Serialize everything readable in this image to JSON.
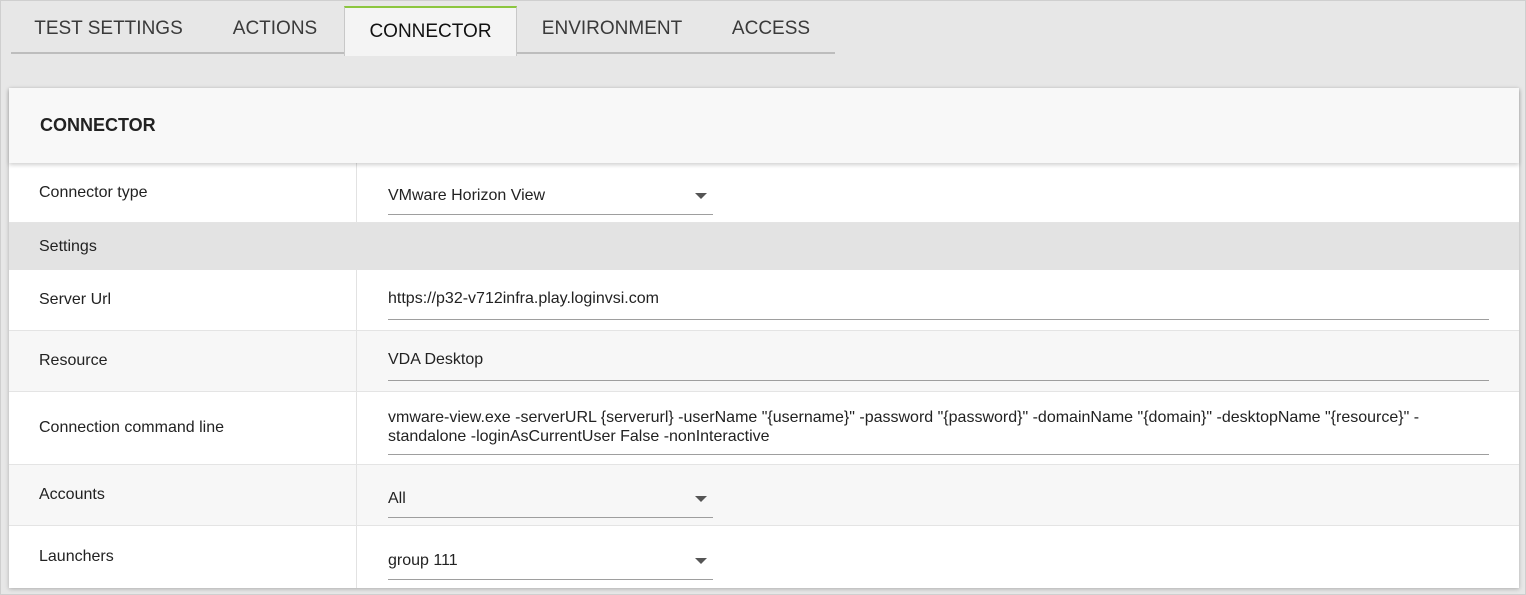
{
  "tabs": [
    {
      "label": "TEST SETTINGS"
    },
    {
      "label": "ACTIONS"
    },
    {
      "label": "CONNECTOR"
    },
    {
      "label": "ENVIRONMENT"
    },
    {
      "label": "ACCESS"
    }
  ],
  "active_tab": "CONNECTOR",
  "panel": {
    "title": "CONNECTOR",
    "connector_type": {
      "label": "Connector type",
      "value": "VMware Horizon View"
    },
    "settings_header": "Settings",
    "server_url": {
      "label": "Server Url",
      "value": "https://p32-v712infra.play.loginvsi.com"
    },
    "resource": {
      "label": "Resource",
      "value": "VDA Desktop"
    },
    "command_line": {
      "label": "Connection command line",
      "value": "vmware-view.exe -serverURL {serverurl} -userName \"{username}\" -password \"{password}\" -domainName \"{domain}\" -desktopName \"{resource}\" -standalone -loginAsCurrentUser False -nonInteractive"
    },
    "accounts": {
      "label": "Accounts",
      "value": "All"
    },
    "launchers": {
      "label": "Launchers",
      "value": "group 111"
    }
  },
  "colors": {
    "accent": "#8cc63f",
    "background": "#e7e7e7"
  },
  "icons": {
    "dropdown": "caret-down-icon"
  }
}
